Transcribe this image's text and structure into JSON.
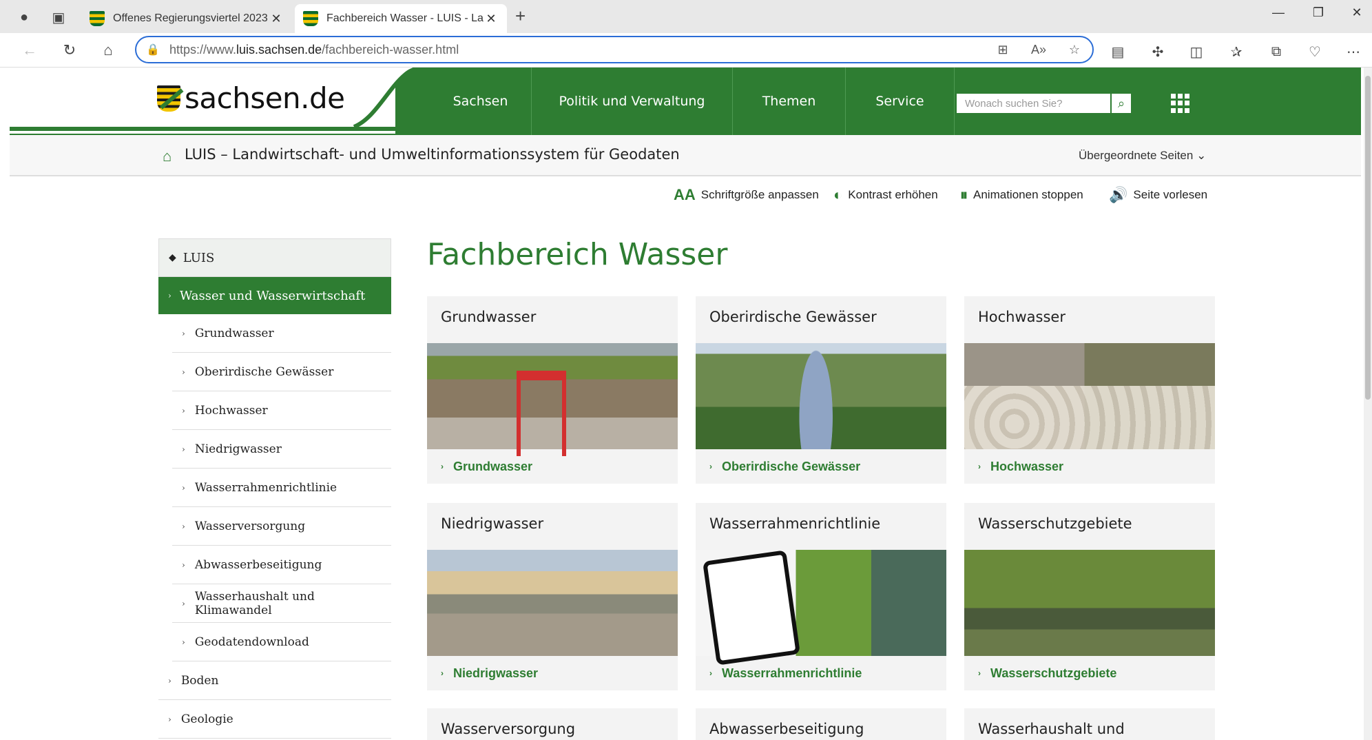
{
  "browser": {
    "tabs": [
      {
        "title": "Offenes Regierungsviertel 2023 -",
        "active": false
      },
      {
        "title": "Fachbereich Wasser - LUIS - Landwirtschaft",
        "active": true
      }
    ],
    "url_prefix": "https://www.",
    "url_host": "luis.sachsen.de",
    "url_path": "/fachbereich-wasser.html"
  },
  "header": {
    "logo_text": "sachsen.de",
    "nav": [
      "Sachsen",
      "Politik und Verwaltung",
      "Themen",
      "Service"
    ],
    "search_placeholder": "Wonach suchen Sie?"
  },
  "subbar": {
    "title": "LUIS – Landwirtschaft- und Umweltinformationssystem für Geodaten",
    "parent_pages": "Übergeordnete Seiten"
  },
  "a11y": {
    "font_size": "Schriftgröße anpassen",
    "contrast": "Kontrast erhöhen",
    "animations": "Animationen stoppen",
    "read_aloud": "Seite vorlesen"
  },
  "sidebar": {
    "root": "LUIS",
    "active": "Wasser und Wasserwirtschaft",
    "sub_items": [
      "Grundwasser",
      "Oberirdische Gewässer",
      "Hochwasser",
      "Niedrigwasser",
      "Wasserrahmenrichtlinie",
      "Wasserversorgung",
      "Abwasserbeseitigung",
      "Wasserhaushalt und Klimawandel",
      "Geodatendownload"
    ],
    "top_items": [
      "Boden",
      "Geologie"
    ]
  },
  "main": {
    "title": "Fachbereich Wasser",
    "cards": [
      {
        "title": "Grundwasser",
        "link": "Grundwasser"
      },
      {
        "title": "Oberirdische Gewässer",
        "link": "Oberirdische Gewässer"
      },
      {
        "title": "Hochwasser",
        "link": "Hochwasser"
      },
      {
        "title": "Niedrigwasser",
        "link": "Niedrigwasser"
      },
      {
        "title": "Wasserrahmenrichtlinie",
        "link": "Wasserrahmenrichtlinie"
      },
      {
        "title": "Wasserschutzgebiete",
        "link": "Wasserschutzgebiete"
      }
    ],
    "partial_cards": [
      "Wasserversorgung",
      "Abwasserbeseitigung",
      "Wasserhaushalt und"
    ]
  },
  "colors": {
    "brand_green": "#2e7d32"
  }
}
